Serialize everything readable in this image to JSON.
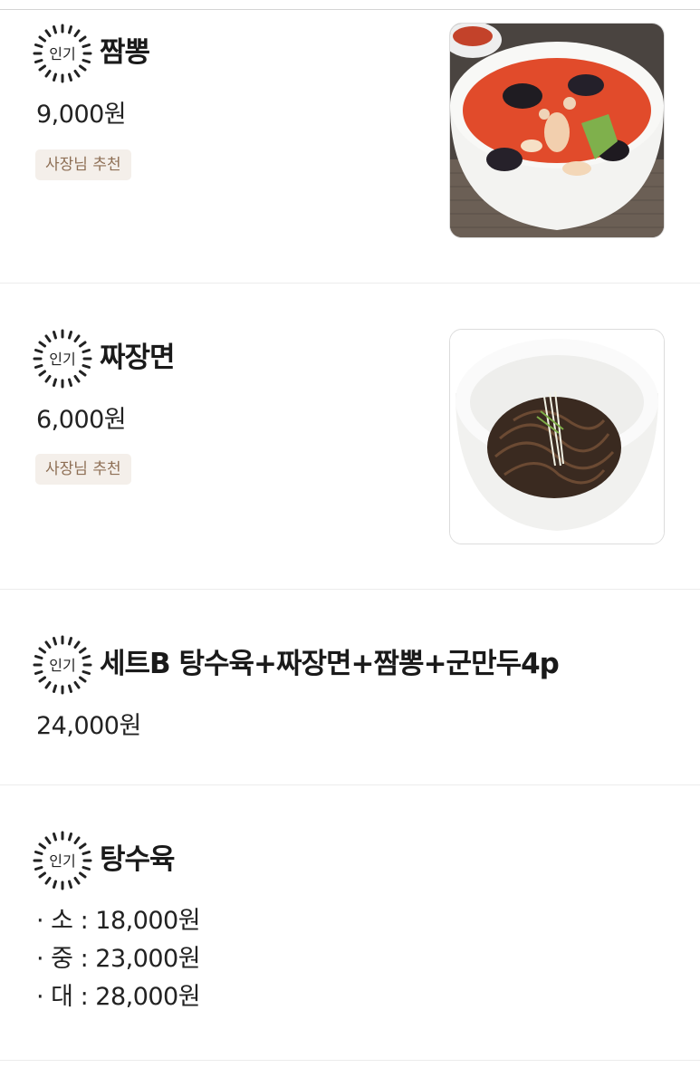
{
  "popular_label": "인기",
  "items": [
    {
      "name": "짬뽕",
      "price": "9,000원",
      "tag": "사장님 추천",
      "image": "jjamppong-photo"
    },
    {
      "name": "짜장면",
      "price": "6,000원",
      "tag": "사장님 추천",
      "image": "jajangmyeon-photo"
    },
    {
      "name": "세트B 탕수육+짜장면+짬뽕+군만두4p",
      "price": "24,000원"
    },
    {
      "name": "탕수육",
      "options": [
        "· 소 : 18,000원",
        "· 중 : 23,000원",
        "· 대 : 28,000원"
      ]
    }
  ],
  "colors": {
    "tag_bg": "#f4efea",
    "tag_text": "#8e6f55",
    "divider": "#ececec"
  }
}
